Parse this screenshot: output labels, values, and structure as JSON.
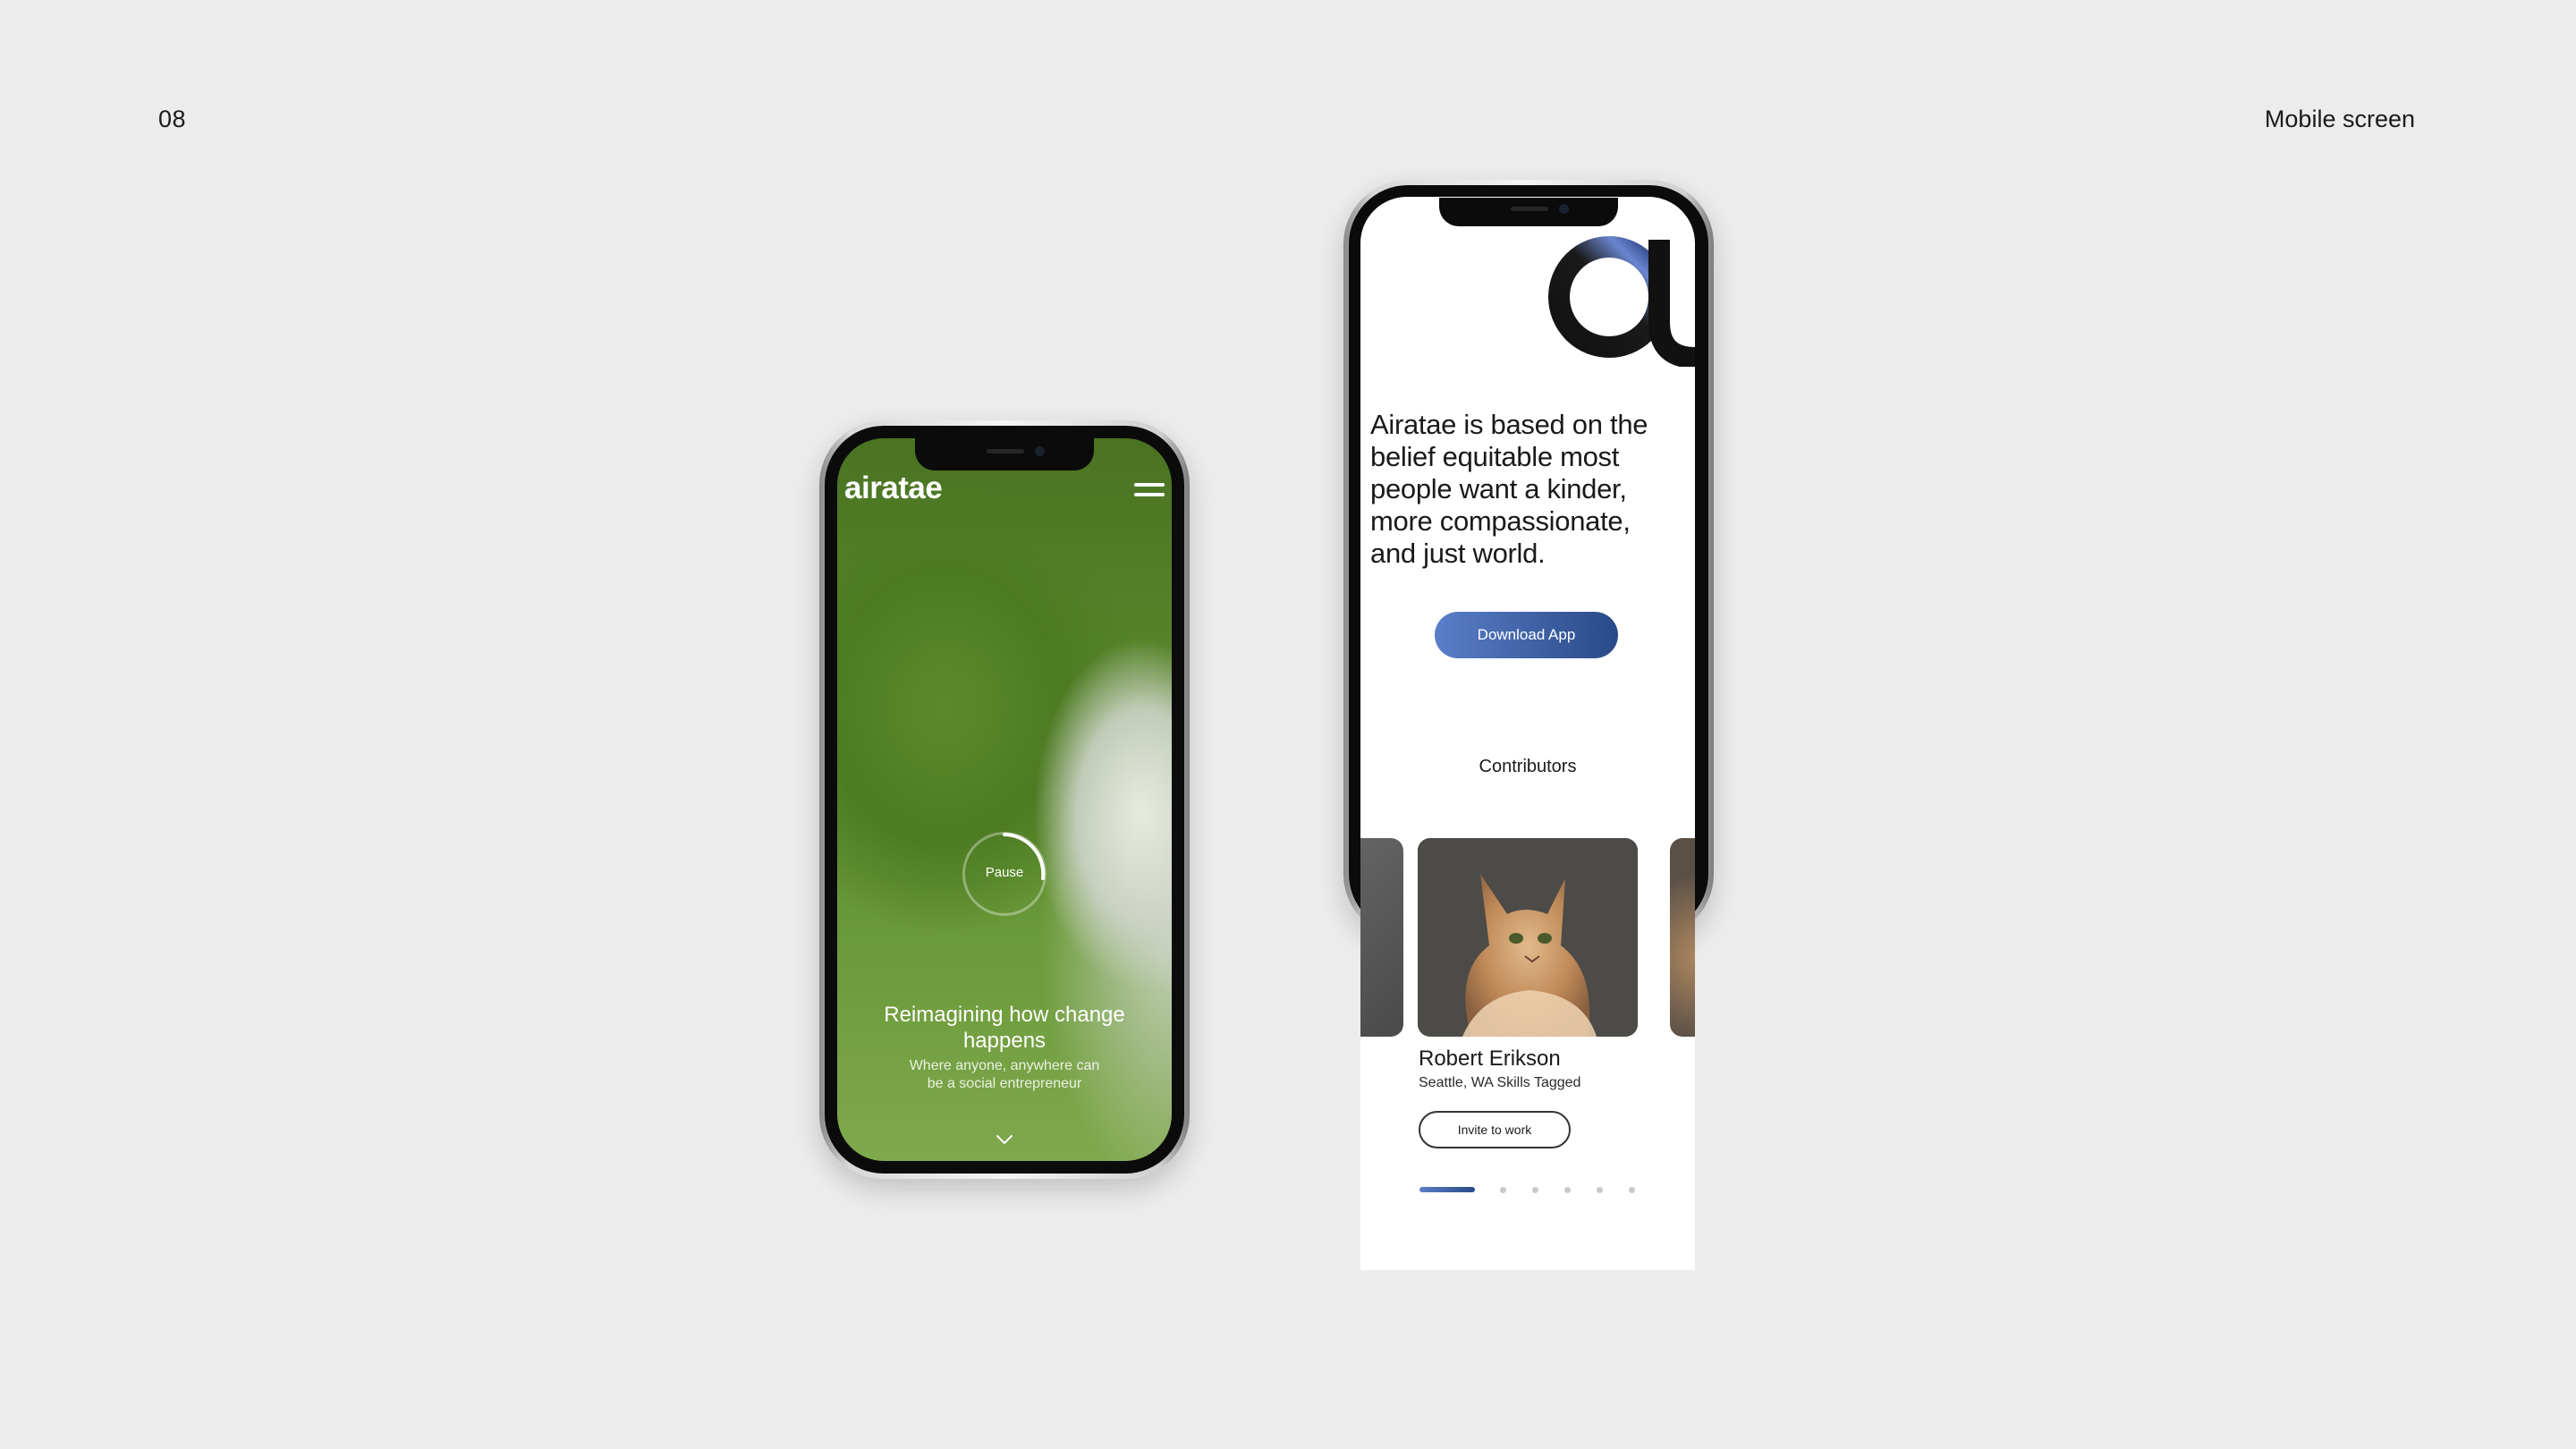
{
  "slide": {
    "number": "08",
    "label": "Mobile screen"
  },
  "phone_home": {
    "logo": "airatae",
    "menu_icon": "hamburger-menu-icon",
    "pause_label": "Pause",
    "hero_title": "Reimagining how change happens",
    "hero_subtitle": "Where anyone, anywhere can be a social entrepreneur",
    "scroll_icon": "chevron-down-icon"
  },
  "phone_about": {
    "brand_mark_icon": "airatae-a-logo-icon",
    "about_text": "Airatae is based on the belief equitable most people want a kinder, more compassionate, and just world.",
    "download_label": "Download App",
    "section_title": "Contributors",
    "contributor": {
      "name": "Robert Erikson",
      "meta": "Seattle, WA  Skills Tagged",
      "invite_label": "Invite to work"
    },
    "carousel": {
      "total": 6,
      "active_index": 0
    }
  },
  "colors": {
    "background": "#ececec",
    "accent_start": "#5a7ec8",
    "accent_end": "#294a88"
  }
}
